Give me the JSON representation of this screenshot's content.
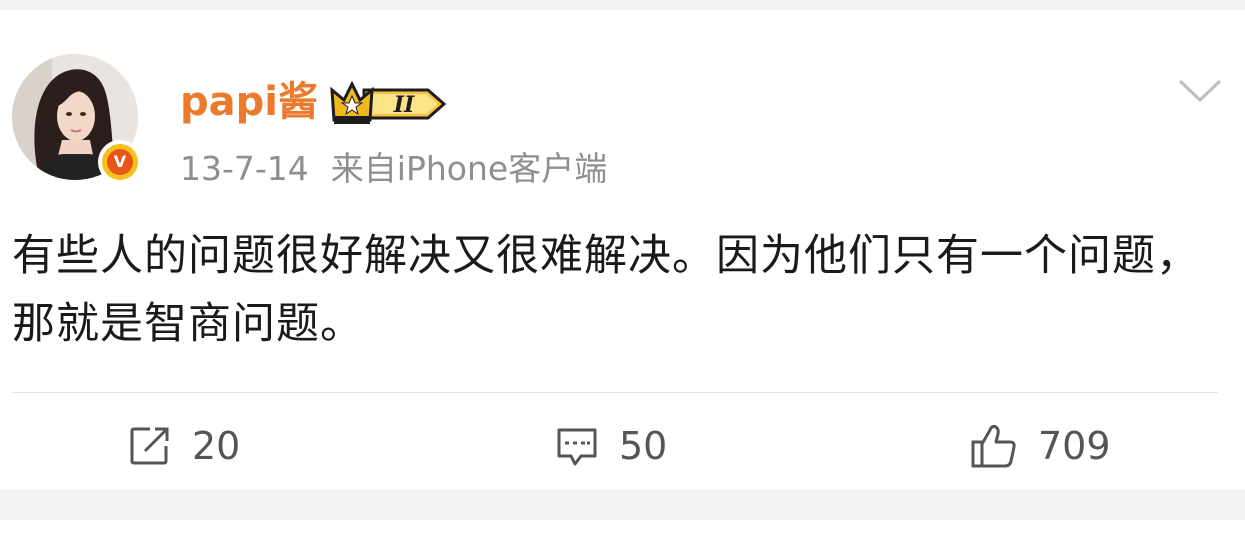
{
  "post": {
    "author": {
      "name": "papi酱",
      "vip_level": "II",
      "verified": true
    },
    "timestamp": "13-7-14",
    "source": "来自iPhone客户端",
    "text": "有些人的问题很好解决又很难解决。因为他们只有一个问题，那就是智商问题。",
    "actions": {
      "repost": {
        "icon": "share-icon",
        "count": "20"
      },
      "comment": {
        "icon": "comment-icon",
        "count": "50"
      },
      "like": {
        "icon": "thumbs-up-icon",
        "count": "709"
      }
    }
  },
  "colors": {
    "username": "#eb7a2d",
    "meta": "#8f8f8f",
    "text": "#1a1a1a",
    "action": "#555555",
    "background": "#f2f2f2",
    "card": "#ffffff"
  },
  "icons": {
    "more": "chevron-down-icon",
    "verify": "verified-v-icon",
    "vip": "crown-badge-icon"
  }
}
